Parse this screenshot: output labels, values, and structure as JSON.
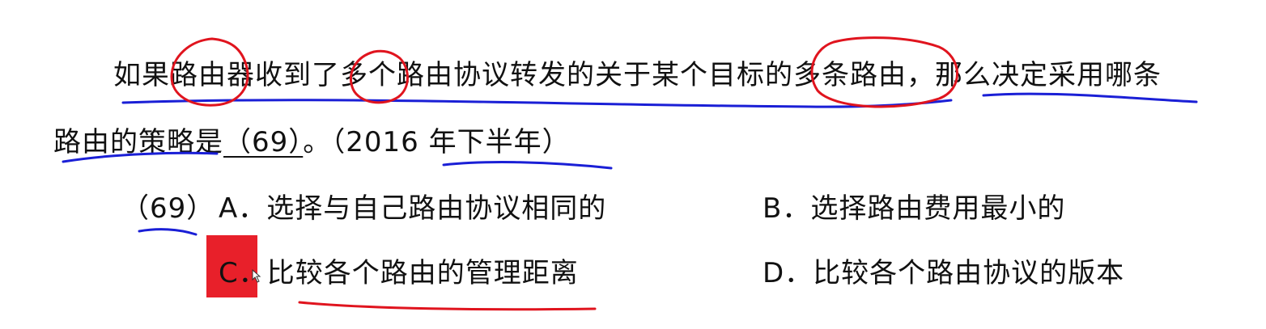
{
  "question": {
    "line1": "如果路由器收到了多个路由协议转发的关于某个目标的多条路由，那么决定采用哪条",
    "line2_prefix": "路由的策略是",
    "blank": "（69）",
    "line2_suffix": "。（2016 年下半年）"
  },
  "question_number": "（69）",
  "options": {
    "a_label": "A．",
    "a_text": "选择与自己路由协议相同的",
    "b_label": "B．",
    "b_text": "选择路由费用最小的",
    "c_label": "C．",
    "c_text": "比较各个路由的管理距离",
    "d_label": "D．",
    "d_text": "比较各个路由协议的版本"
  },
  "colors": {
    "text": "#111111",
    "highlight_box": "#e8202a",
    "blue_ink": "#1a1fd6",
    "red_ink": "#e0141e"
  }
}
